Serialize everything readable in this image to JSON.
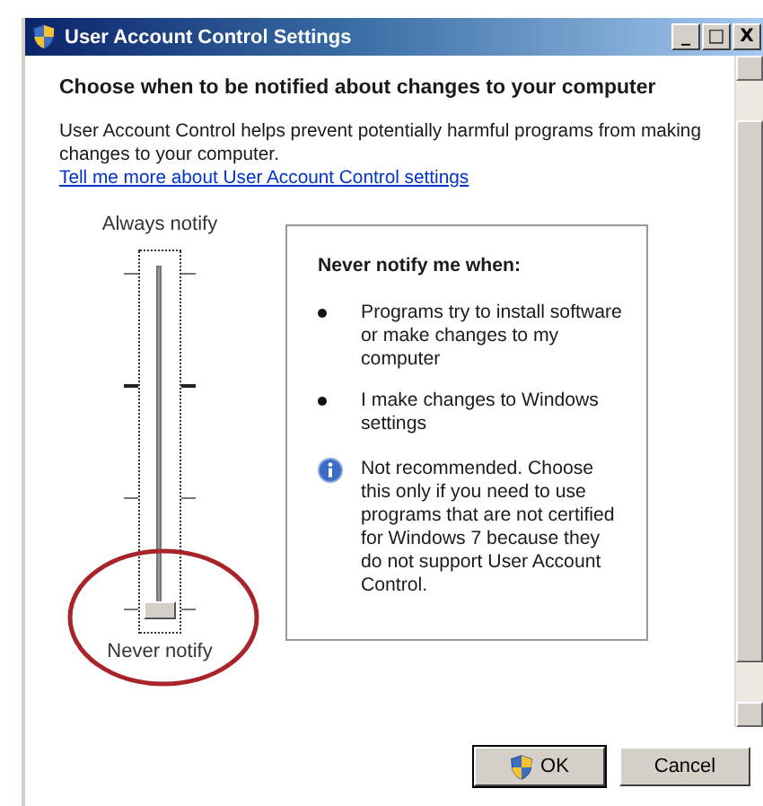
{
  "window": {
    "title": "User Account Control Settings",
    "controls": [
      "_",
      "□",
      "X"
    ]
  },
  "heading": "Choose when to be notified about changes to your computer",
  "description": "User Account Control helps prevent potentially harmful programs from making changes to your computer.",
  "link": "Tell me more about User Account Control settings",
  "slider": {
    "top_label": "Always notify",
    "bottom_label": "Never notify",
    "level": 0
  },
  "panel": {
    "title": "Never notify me when:",
    "bullets": [
      "Programs try to install software or make changes to my computer",
      "I make changes to Windows settings"
    ],
    "note": "Not recommended. Choose this only if you need to use programs that are not certified for Windows 7 because they do not support User Account Control."
  },
  "buttons": [
    {
      "label": "OK",
      "kind": "shield",
      "default": true
    },
    {
      "label": "Cancel",
      "kind": "plain",
      "default": false
    }
  ]
}
